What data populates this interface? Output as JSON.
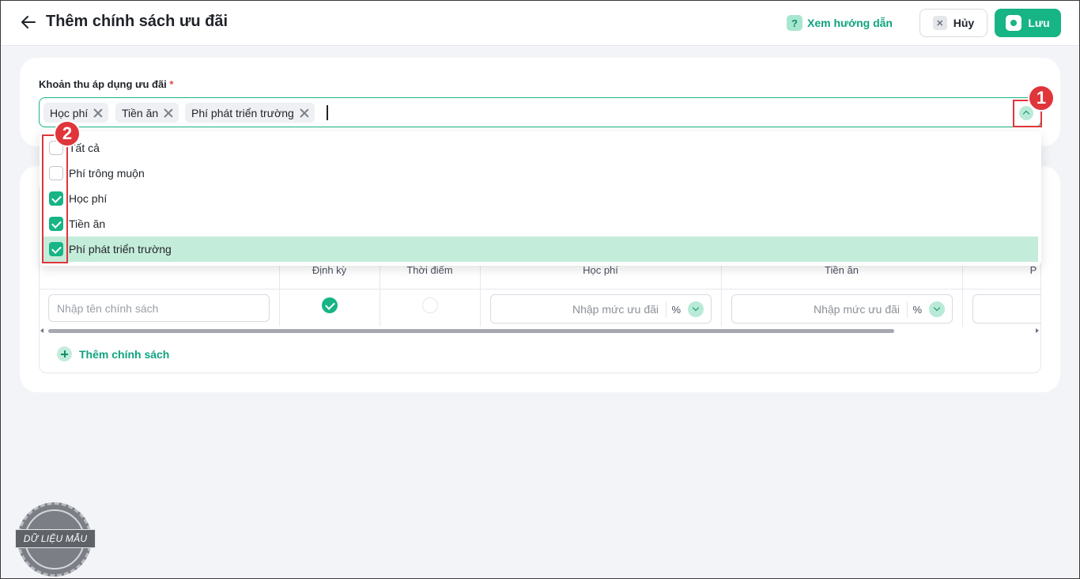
{
  "header": {
    "title": "Thêm chính sách ưu đãi",
    "guide_label": "Xem hướng dẫn",
    "cancel_label": "Hủy",
    "save_label": "Lưu"
  },
  "field": {
    "label": "Khoản thu áp dụng ưu đãi",
    "required_mark": "*",
    "tags": [
      "Học phí",
      "Tiền ăn",
      "Phí phát triển trường"
    ]
  },
  "dropdown": {
    "options": [
      {
        "label": "Tất cả",
        "checked": false
      },
      {
        "label": "Phí trông muộn",
        "checked": false
      },
      {
        "label": "Học phí",
        "checked": true
      },
      {
        "label": "Tiền ăn",
        "checked": true
      },
      {
        "label": "Phí phát triển trường",
        "checked": true
      }
    ]
  },
  "table": {
    "headers": [
      "Định kỳ",
      "Thời điểm",
      "Học phí",
      "Tiền ăn",
      "P"
    ],
    "row": {
      "name_placeholder": "Nhập tên chính sách",
      "amount_placeholder": "Nhập mức ưu đãi",
      "unit": "%"
    },
    "add_label": "Thêm chính sách"
  },
  "annotations": [
    "1",
    "2"
  ],
  "watermark": "DỮ LIỆU MẪU",
  "colors": {
    "accent": "#17b485",
    "annotation": "#e0353b"
  }
}
